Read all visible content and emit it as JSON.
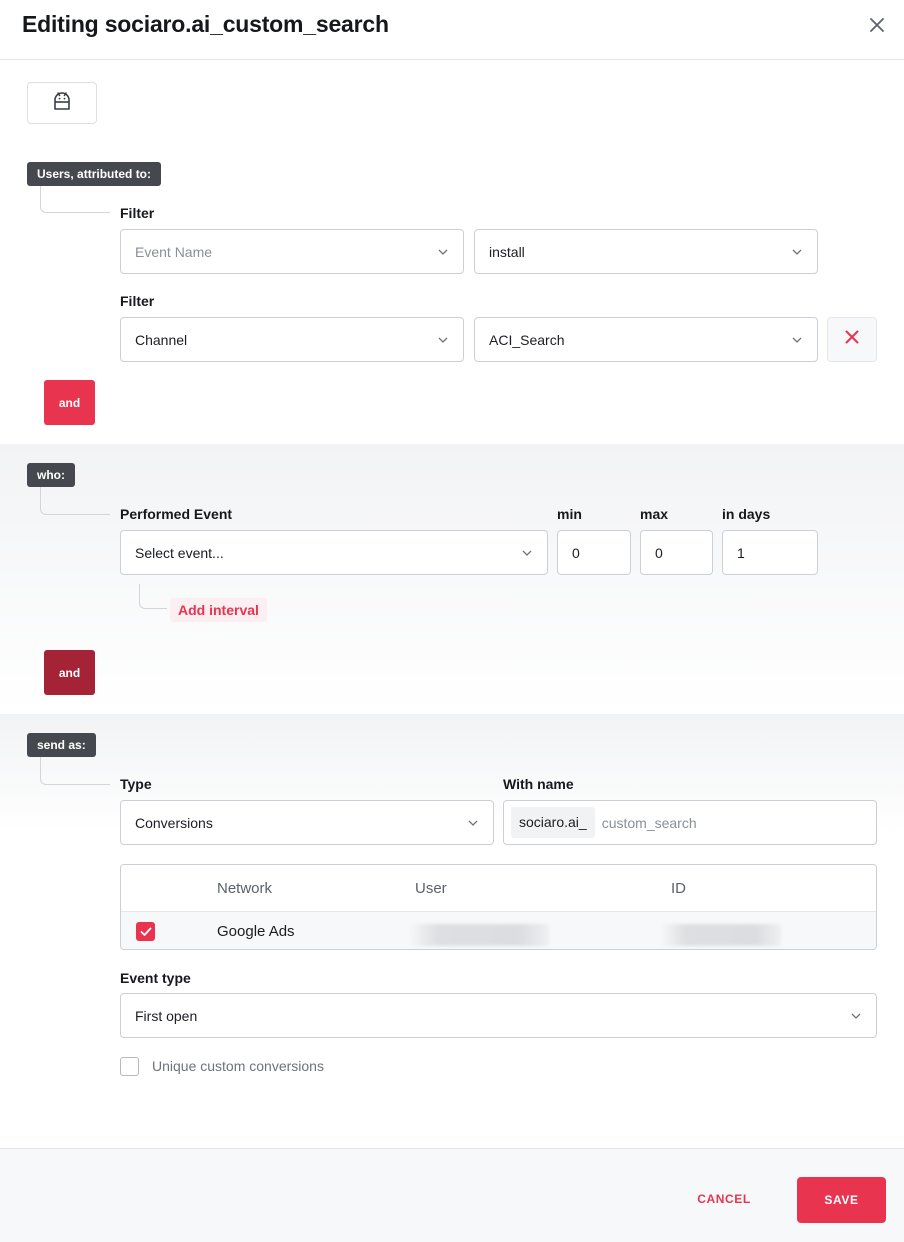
{
  "header": {
    "title": "Editing sociaro.ai_custom_search",
    "close_icon": "close-icon"
  },
  "platform": {
    "icon": "android-icon"
  },
  "attributed": {
    "tag": "Users, attributed to:",
    "filters": [
      {
        "label": "Filter",
        "field": "Event Name",
        "value": "install"
      },
      {
        "label": "Filter",
        "field": "Channel",
        "value": "ACI_Search"
      }
    ],
    "and_label": "and"
  },
  "who": {
    "tag": "who:",
    "performed_event_label": "Performed Event",
    "event_placeholder": "Select event...",
    "min_label": "min",
    "max_label": "max",
    "days_label": "in days",
    "min_value": "0",
    "max_value": "0",
    "days_value": "1",
    "add_interval": "Add interval",
    "and_label": "and"
  },
  "send_as": {
    "tag": "send as:",
    "type_label": "Type",
    "type_value": "Conversions",
    "name_label": "With name",
    "name_prefix": "sociaro.ai_",
    "name_value": "custom_search",
    "table": {
      "headers": [
        "Network",
        "User",
        "ID"
      ],
      "rows": [
        {
          "checked": true,
          "network": "Google Ads"
        }
      ]
    },
    "event_type_label": "Event type",
    "event_type_value": "First open",
    "unique_label": "Unique custom conversions"
  },
  "footer": {
    "cancel": "CANCEL",
    "save": "SAVE"
  },
  "colors": {
    "accent": "#e8344e",
    "accent_dark": "#a42336",
    "tag_bg": "#45494f"
  }
}
